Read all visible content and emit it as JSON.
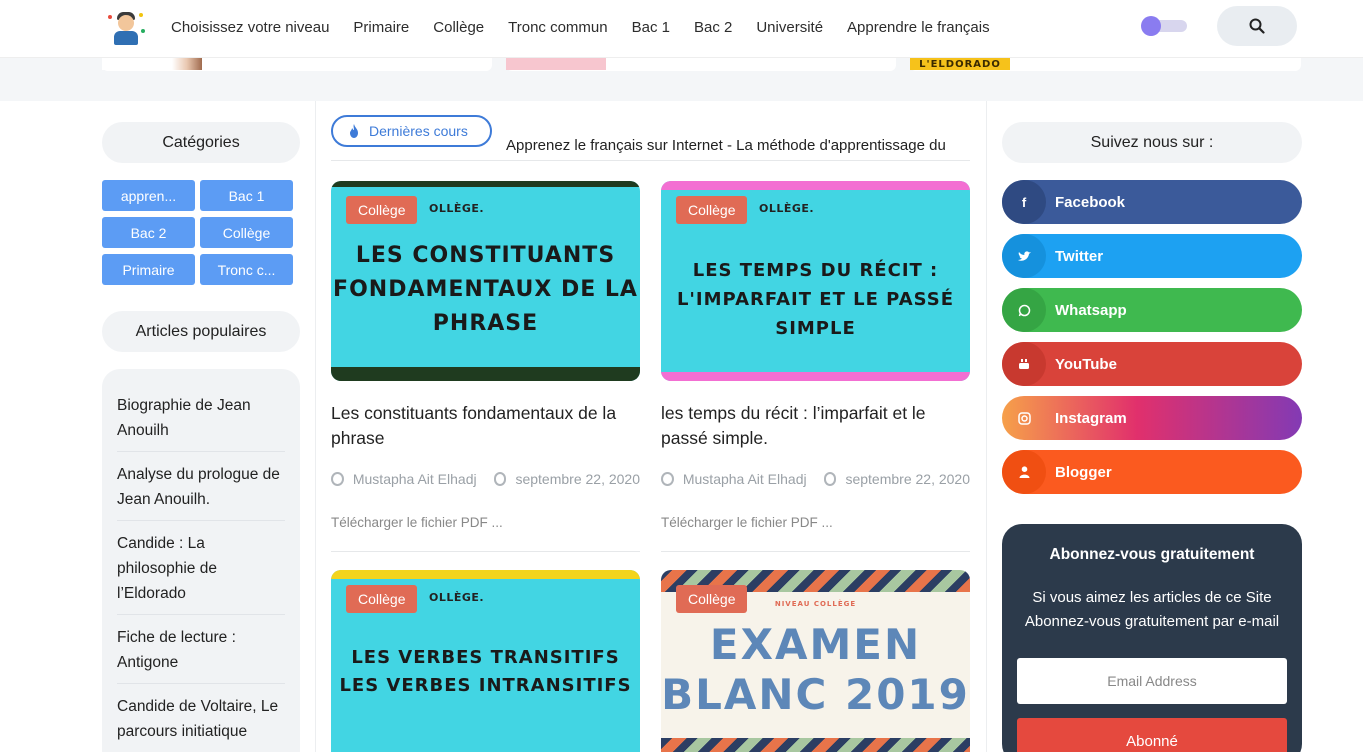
{
  "header": {
    "nav": [
      "Choisissez votre niveau",
      "Primaire",
      "Collège",
      "Tronc commun",
      "Bac 1",
      "Bac 2",
      "Université",
      "Apprendre le français"
    ]
  },
  "strip": {
    "eldorado_label": "L'ELDORADO"
  },
  "left": {
    "categories_title": "Catégories",
    "categories": [
      "appren...",
      "Bac 1",
      "Bac 2",
      "Collège",
      "Primaire",
      "Tronc c..."
    ],
    "popular_title": "Articles populaires",
    "popular": [
      "Biographie de Jean Anouilh",
      "Analyse du prologue de Jean Anouilh.",
      "Candide : La philosophie de l’Eldorado",
      "Fiche de lecture : Antigone",
      "Candide de Voltaire, Le parcours initiatique"
    ]
  },
  "main": {
    "latest_label": "Dernières cours",
    "ticker": "Apprenez le français sur Internet - La méthode d'apprentissage du",
    "posts": [
      {
        "badge": "Collège",
        "img_label": "OLLÈGE.",
        "headline": [
          "LES CONSTITUANTS",
          "FONDAMENTAUX DE LA",
          "PHRASE"
        ],
        "title": "Les constituants fondamentaux de la phrase",
        "author": "Mustapha Ait Elhadj",
        "date": "septembre 22, 2020",
        "excerpt": "Télécharger le fichier PDF ..."
      },
      {
        "badge": "Collège",
        "img_label": "OLLÈGE.",
        "headline": [
          "LES TEMPS DU RÉCIT :",
          "L'IMPARFAIT ET LE PASSÉ",
          "SIMPLE"
        ],
        "title": "les temps du récit : l’imparfait et le passé simple.",
        "author": "Mustapha Ait Elhadj",
        "date": "septembre 22, 2020",
        "excerpt": "Télécharger le fichier PDF ..."
      },
      {
        "badge": "Collège",
        "img_label": "OLLÈGE.",
        "headline": [
          "LES VERBES TRANSITIFS",
          "LES VERBES INTRANSITIFS"
        ]
      },
      {
        "badge": "Collège",
        "img_label": "NIVEAU COLLÈGE",
        "headline": [
          "EXAMEN",
          "BLANC 2019"
        ]
      }
    ]
  },
  "right": {
    "follow_title": "Suivez nous sur :",
    "social": [
      {
        "label": "Facebook",
        "icon": "facebook-icon",
        "color": "#3b5a9a"
      },
      {
        "label": "Twitter",
        "icon": "twitter-icon",
        "color": "#1da1f2"
      },
      {
        "label": "Whatsapp",
        "icon": "whatsapp-icon",
        "color": "#3fb94f"
      },
      {
        "label": "YouTube",
        "icon": "youtube-icon",
        "color": "#d9433a"
      },
      {
        "label": "Instagram",
        "icon": "instagram-icon",
        "color": "#c13584"
      },
      {
        "label": "Blogger",
        "icon": "blogger-icon",
        "color": "#fb5a1f"
      }
    ],
    "subscribe": {
      "title": "Abonnez-vous gratuitement",
      "desc_line1": "Si vous aimez les articles de ce Site",
      "desc_line2": "Abonnez-vous gratuitement par e-mail",
      "email_placeholder": "Email Address",
      "button": "Abonné"
    }
  }
}
